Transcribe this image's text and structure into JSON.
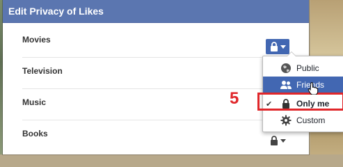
{
  "dialog": {
    "title": "Edit Privacy of Likes"
  },
  "rows": [
    {
      "label": "Movies",
      "privacy_icon": "lock-icon"
    },
    {
      "label": "Television",
      "privacy_icon": "lock-icon"
    },
    {
      "label": "Music",
      "privacy_icon": "lock-icon"
    },
    {
      "label": "Books",
      "privacy_icon": "lock-icon"
    }
  ],
  "privacy_menu": {
    "items": [
      {
        "label": "Public",
        "icon": "globe-icon",
        "state": "normal"
      },
      {
        "label": "Friends",
        "icon": "friends-icon",
        "state": "hover"
      },
      {
        "label": "Only me",
        "icon": "lock-icon",
        "state": "selected",
        "check": "✔"
      },
      {
        "label": "Custom",
        "icon": "gear-icon",
        "state": "normal"
      }
    ]
  },
  "annotation": {
    "step": "5",
    "color": "#e0262a"
  },
  "colors": {
    "header": "#5b76b0",
    "accent": "#4267b2"
  }
}
